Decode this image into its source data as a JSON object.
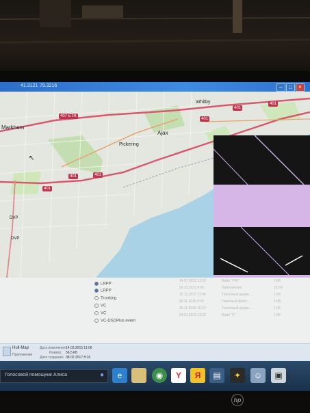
{
  "window": {
    "status_left": "41.3121",
    "status_right": "79.3216"
  },
  "map": {
    "labels": {
      "markham": "Markham",
      "whitby": "Whitby",
      "ajax": "Ajax",
      "pickering": "Pickering",
      "dvp_1": "DVP",
      "dvp_2": "DVP"
    },
    "shields": {
      "etr": "407 ETR",
      "h401_a": "401",
      "h401_b": "401",
      "h401_c": "401",
      "h401_d": "401",
      "h401_e": "401",
      "h401_f": "401"
    }
  },
  "tree": {
    "items": [
      {
        "label": "LRPP",
        "checked": true
      },
      {
        "label": "LRPP",
        "checked": true
      },
      {
        "label": "Trunking",
        "checked": false
      },
      {
        "label": "VC",
        "checked": false
      },
      {
        "label": "VC",
        "checked": false
      },
      {
        "label": "VC-DSDPlus.event",
        "checked": false
      }
    ]
  },
  "files": {
    "rows": [
      {
        "date": "24.07.2015 13:52",
        "type": "Файл \"PRI\"",
        "size": "1 КБ"
      },
      {
        "date": "05.12.2015 4:50",
        "type": "Приложение",
        "size": "25 КБ"
      },
      {
        "date": "25.12.2015 12:45",
        "type": "Текстовый докум...",
        "size": "1 КБ"
      },
      {
        "date": "06.11.2015 9:06",
        "type": "Пакетный файл ...",
        "size": "1 КБ"
      },
      {
        "date": "06.11.2015 15:23",
        "type": "Текстовый докум...",
        "size": "1 КБ"
      },
      {
        "date": "04.01.2016 13:22",
        "type": "Файл \"E\"",
        "size": "1 КБ"
      }
    ]
  },
  "details": {
    "name": "Hull-Map",
    "kind": "Приложение",
    "modified_label": "Дата изменения:",
    "modified_value": "14.03.2015 11:06",
    "size_label": "Размер:",
    "size_value": "56,5 КБ",
    "created_label": "Дата создания:",
    "created_value": "08.02.2017 8:16"
  },
  "taskbar": {
    "search_text": "Голосовой помощник Алиса",
    "icons": [
      "mic-icon",
      "ie-icon",
      "folder-icon",
      "chrome-icon",
      "yandex-icon",
      "yandex-browser-icon",
      "media-icon",
      "dsd-icon",
      "photo-icon",
      "app-icon"
    ]
  },
  "monitor": {
    "brand": "hp"
  }
}
